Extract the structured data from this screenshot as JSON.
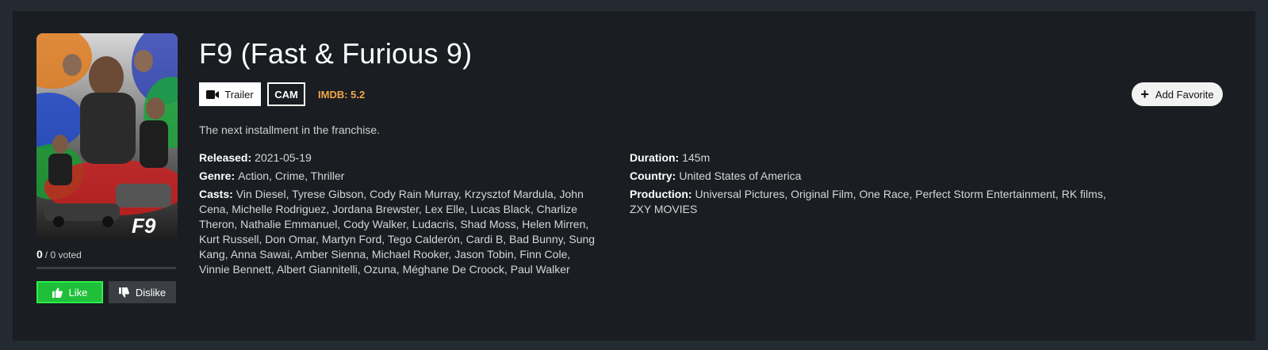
{
  "colors": {
    "page_bg": "#242a31",
    "panel_bg": "#1a1d21",
    "like_green": "#1fbf3a",
    "imdb_orange": "#f0a646"
  },
  "movie": {
    "title": "F9 (Fast & Furious 9)",
    "poster_text": "F9",
    "trailer_label": "Trailer",
    "quality": "CAM",
    "imdb": "IMDB: 5.2",
    "add_favorite_label": "Add Favorite",
    "description": "The next installment in the franchise."
  },
  "rating": {
    "score": "0",
    "voted": "/ 0 voted",
    "like_label": "Like",
    "dislike_label": "Dislike"
  },
  "details_left": {
    "released_label": "Released:",
    "released": "2021-05-19",
    "genre_label": "Genre:",
    "genre": "Action, Crime, Thriller",
    "casts_label": "Casts:",
    "casts": "Vin Diesel, Tyrese Gibson, Cody Rain Murray, Krzysztof Mardula, John Cena, Michelle Rodriguez, Jordana Brewster, Lex Elle, Lucas Black, Charlize Theron, Nathalie Emmanuel, Cody Walker, Ludacris, Shad Moss, Helen Mirren, Kurt Russell, Don Omar, Martyn Ford, Tego Calderón, Cardi B, Bad Bunny, Sung Kang, Anna Sawai, Amber Sienna, Michael Rooker, Jason Tobin, Finn Cole, Vinnie Bennett, Albert Giannitelli, Ozuna, Méghane De Croock, Paul Walker"
  },
  "details_right": {
    "duration_label": "Duration:",
    "duration": "145m",
    "country_label": "Country:",
    "country": "United States of America",
    "production_label": "Production:",
    "production": "Universal Pictures, Original Film, One Race, Perfect Storm Entertainment, RK films, ZXY MOVIES"
  },
  "icons": {
    "trailer": "video-camera-icon",
    "favorite": "plus-icon",
    "like": "thumbs-up-icon",
    "dislike": "thumbs-down-icon"
  }
}
